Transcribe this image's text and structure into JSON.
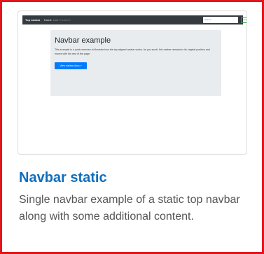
{
  "thumbnail": {
    "navbar": {
      "brand": "Top navbar",
      "links": [
        "Home",
        "Link",
        "Disabled"
      ],
      "search_placeholder": "Search",
      "search_button": "Search"
    },
    "jumbotron": {
      "title": "Navbar example",
      "lead": "This example is a quick exercise to illustrate how the top-aligned navbar works. As you scroll, this navbar remains in its original position and moves with the rest of the page.",
      "button": "View navbar docs »"
    }
  },
  "card": {
    "title": "Navbar static",
    "description": "Single navbar example of a static top navbar along with some additional content."
  },
  "colors": {
    "highlight_border": "#e3161d",
    "title": "#0d6ebd",
    "text": "#555555",
    "navbar_dark": "#343a40",
    "jumbotron_bg": "#e9ecef",
    "primary_button": "#007bff"
  }
}
